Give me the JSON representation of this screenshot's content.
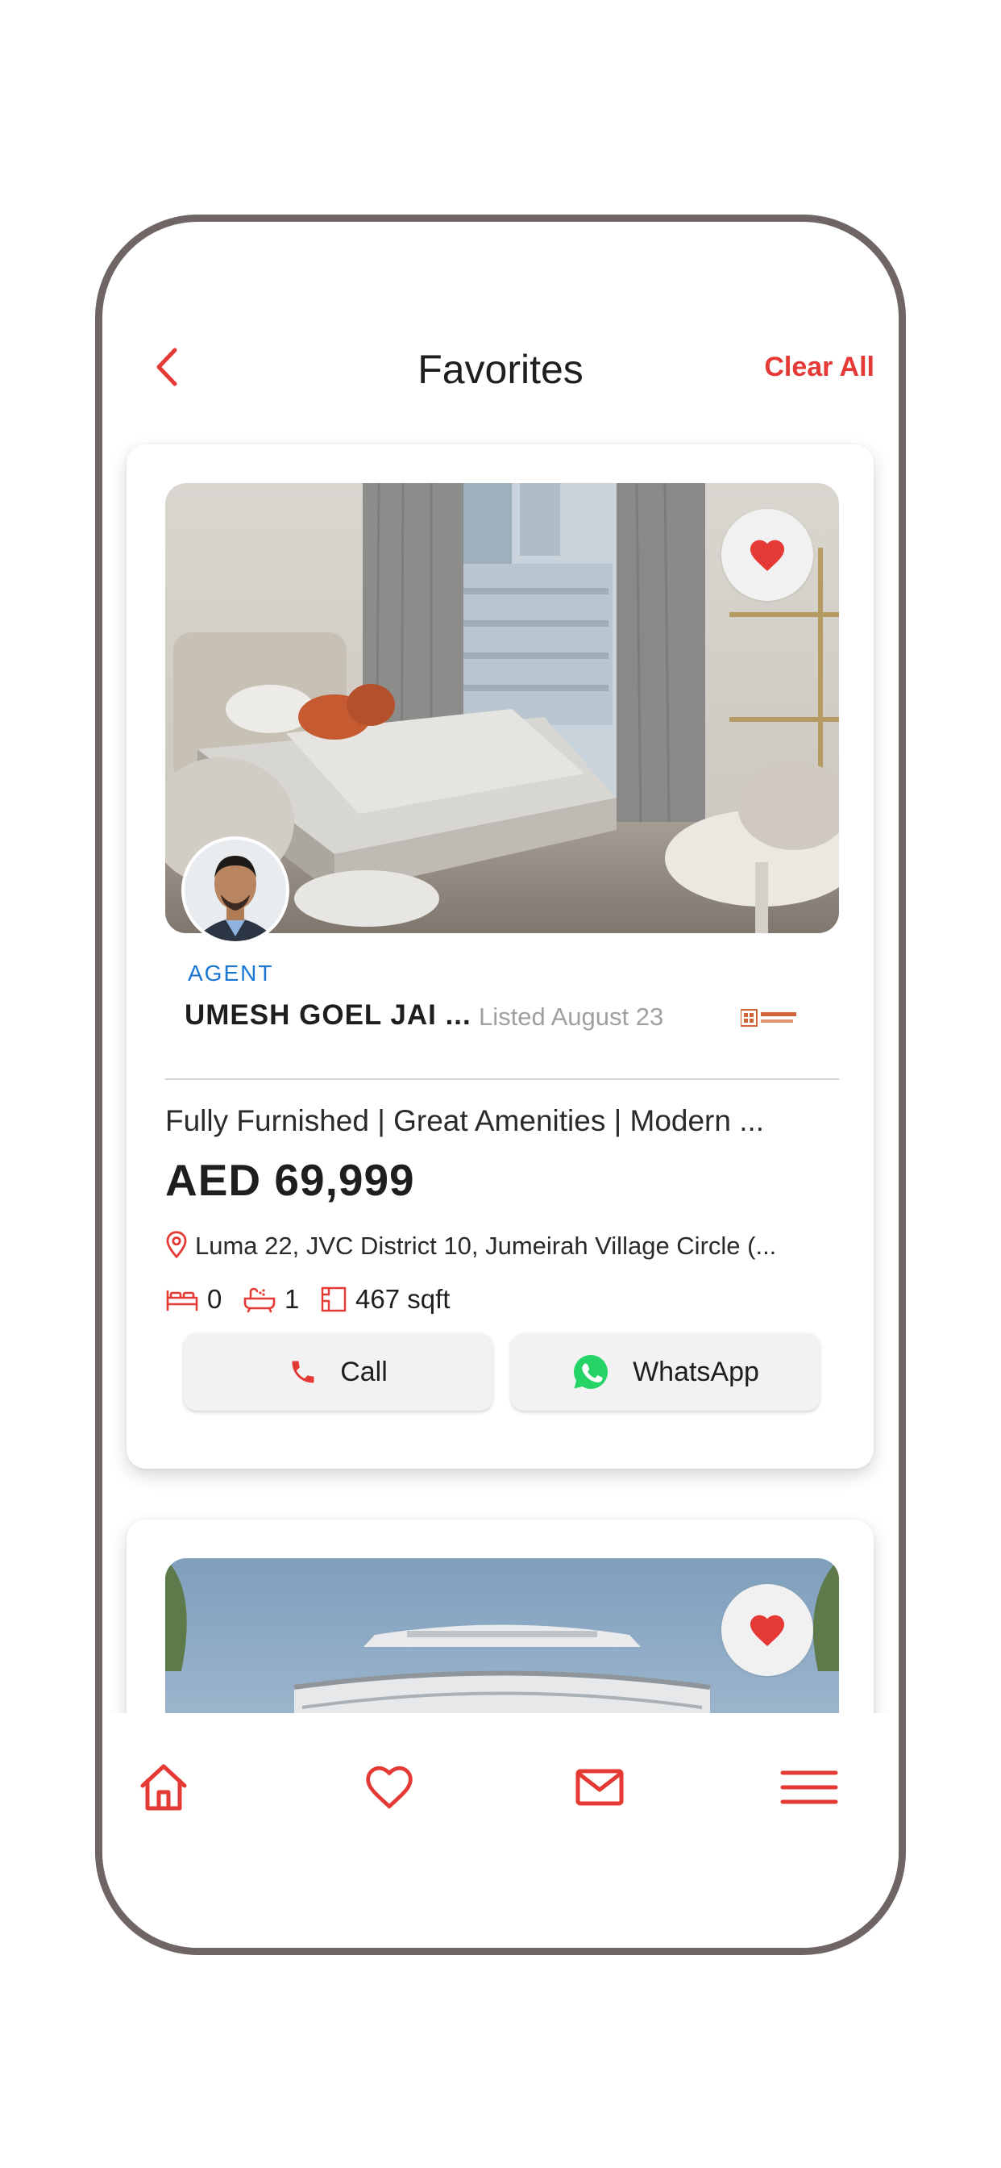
{
  "header": {
    "back_icon": "chevron-left-icon",
    "title": "Favorites",
    "clear_all": "Clear All"
  },
  "colors": {
    "accent": "#e53935",
    "agent_label": "#1976d2",
    "muted_text": "#a0a0a0",
    "whatsapp": "#25d366",
    "frame": "#6e6564"
  },
  "listings": [
    {
      "favorite_icon": "heart-filled-icon",
      "agent_label": "AGENT",
      "agent_name": "UMESH GOEL JAI ...",
      "listed": "Listed August 23",
      "title": "Fully Furnished | Great Amenities | Modern ...",
      "price": "AED 69,999",
      "location": "Luma 22, JVC District 10, Jumeirah Village Circle (...",
      "bedrooms": "0",
      "bathrooms": "1",
      "area": "467 sqft",
      "call_label": "Call",
      "whatsapp_label": "WhatsApp"
    },
    {
      "favorite_icon": "heart-filled-icon"
    }
  ],
  "tabbar": {
    "items": [
      "home-icon",
      "heart-outline-icon",
      "mail-icon",
      "menu-icon"
    ]
  }
}
